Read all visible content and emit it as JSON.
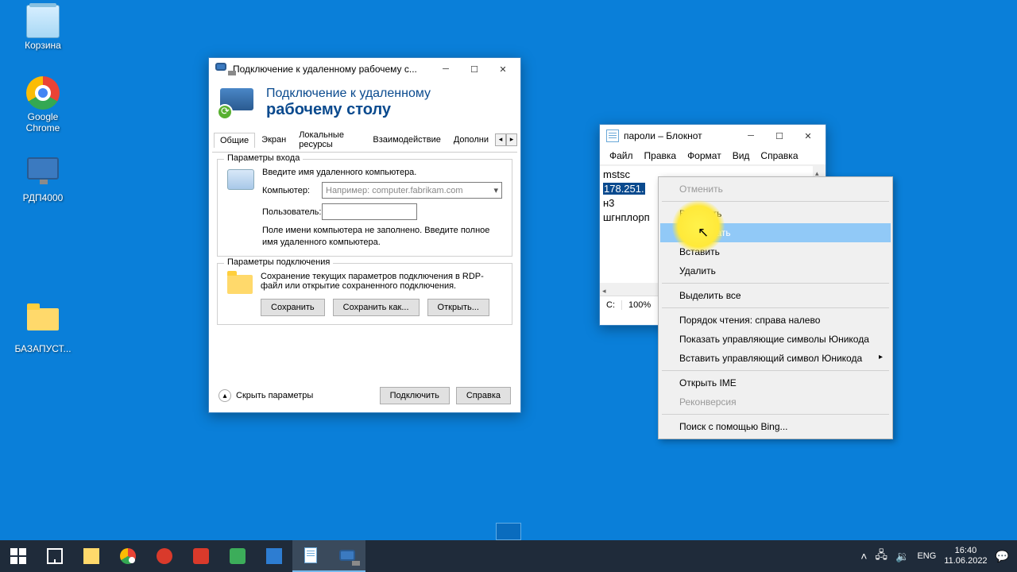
{
  "desktop": {
    "icons": [
      {
        "label": "Корзина"
      },
      {
        "label": "Google Chrome"
      },
      {
        "label": "РДП4000"
      },
      {
        "label": "БАЗАПУСТ..."
      }
    ]
  },
  "rdp": {
    "title": "Подключение к удаленному рабочему с...",
    "banner_line1": "Подключение к удаленному",
    "banner_line2": "рабочему столу",
    "tabs": [
      "Общие",
      "Экран",
      "Локальные ресурсы",
      "Взаимодействие",
      "Дополни"
    ],
    "group_login": {
      "title": "Параметры входа",
      "prompt": "Введите имя удаленного компьютера.",
      "computer_label": "Компьютер:",
      "computer_placeholder": "Например: computer.fabrikam.com",
      "user_label": "Пользователь:",
      "hint": "Поле имени компьютера не заполнено. Введите полное имя удаленного компьютера."
    },
    "group_conn": {
      "title": "Параметры подключения",
      "desc": "Сохранение текущих параметров подключения в RDP-файл или открытие сохраненного подключения.",
      "save": "Сохранить",
      "save_as": "Сохранить как...",
      "open": "Открыть..."
    },
    "hide_params": "Скрыть параметры",
    "connect": "Подключить",
    "help": "Справка"
  },
  "notepad": {
    "title": "пароли – Блокнот",
    "menu": [
      "Файл",
      "Правка",
      "Формат",
      "Вид",
      "Справка"
    ],
    "lines": {
      "l1": "mstsc",
      "l2": "178.251.",
      "l3": "н3",
      "l4": "шгнплорп"
    },
    "status": {
      "col": "С:",
      "zoom": "100%"
    }
  },
  "context_menu": {
    "items": [
      {
        "label": "Отменить",
        "disabled": true
      },
      {
        "sep": true
      },
      {
        "label": "Вырезать"
      },
      {
        "label": "Копировать",
        "selected": true
      },
      {
        "label": "Вставить"
      },
      {
        "label": "Удалить"
      },
      {
        "sep": true
      },
      {
        "label": "Выделить все"
      },
      {
        "sep": true
      },
      {
        "label": "Порядок чтения: справа налево"
      },
      {
        "label": "Показать управляющие символы Юникода"
      },
      {
        "label": "Вставить управляющий символ Юникода",
        "arrow": true
      },
      {
        "sep": true
      },
      {
        "label": "Открыть IME"
      },
      {
        "label": "Реконверсия",
        "disabled": true
      },
      {
        "sep": true
      },
      {
        "label": "Поиск с помощью Bing..."
      }
    ]
  },
  "taskbar": {
    "lang": "ENG",
    "time": "16:40",
    "date": "11.06.2022"
  }
}
